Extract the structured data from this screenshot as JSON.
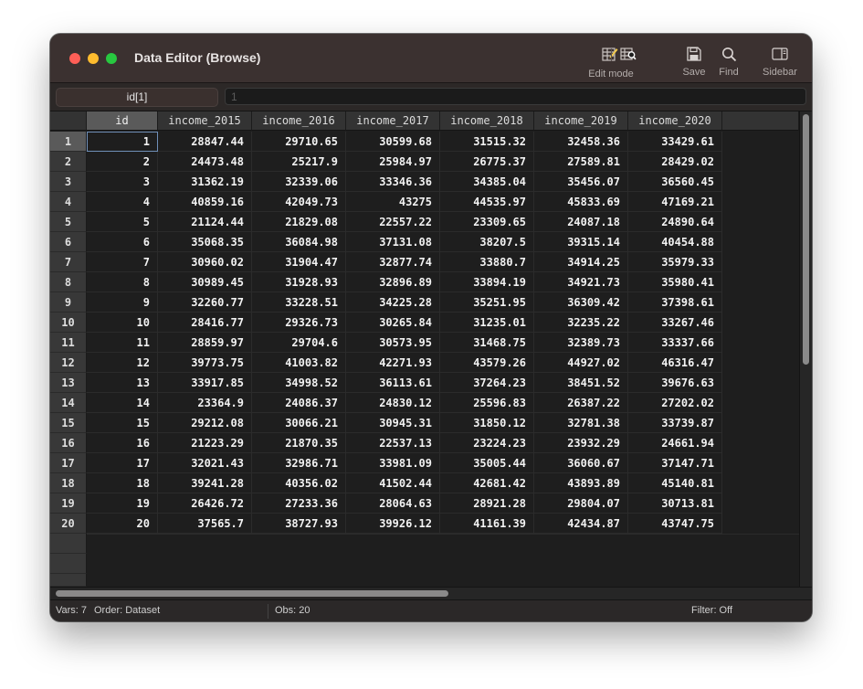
{
  "window": {
    "title": "Data Editor (Browse)"
  },
  "toolbar": {
    "edit_mode_label": "Edit mode",
    "save_label": "Save",
    "find_label": "Find",
    "sidebar_label": "Sidebar"
  },
  "command_bar": {
    "variable_cell": "id[1]",
    "value": "1"
  },
  "table": {
    "columns": [
      "id",
      "income_2015",
      "income_2016",
      "income_2017",
      "income_2018",
      "income_2019",
      "income_2020"
    ],
    "rows": [
      {
        "n": "1",
        "cells": [
          "1",
          "28847.44",
          "29710.65",
          "30599.68",
          "31515.32",
          "32458.36",
          "33429.61"
        ]
      },
      {
        "n": "2",
        "cells": [
          "2",
          "24473.48",
          "25217.9",
          "25984.97",
          "26775.37",
          "27589.81",
          "28429.02"
        ]
      },
      {
        "n": "3",
        "cells": [
          "3",
          "31362.19",
          "32339.06",
          "33346.36",
          "34385.04",
          "35456.07",
          "36560.45"
        ]
      },
      {
        "n": "4",
        "cells": [
          "4",
          "40859.16",
          "42049.73",
          "43275",
          "44535.97",
          "45833.69",
          "47169.21"
        ]
      },
      {
        "n": "5",
        "cells": [
          "5",
          "21124.44",
          "21829.08",
          "22557.22",
          "23309.65",
          "24087.18",
          "24890.64"
        ]
      },
      {
        "n": "6",
        "cells": [
          "6",
          "35068.35",
          "36084.98",
          "37131.08",
          "38207.5",
          "39315.14",
          "40454.88"
        ]
      },
      {
        "n": "7",
        "cells": [
          "7",
          "30960.02",
          "31904.47",
          "32877.74",
          "33880.7",
          "34914.25",
          "35979.33"
        ]
      },
      {
        "n": "8",
        "cells": [
          "8",
          "30989.45",
          "31928.93",
          "32896.89",
          "33894.19",
          "34921.73",
          "35980.41"
        ]
      },
      {
        "n": "9",
        "cells": [
          "9",
          "32260.77",
          "33228.51",
          "34225.28",
          "35251.95",
          "36309.42",
          "37398.61"
        ]
      },
      {
        "n": "10",
        "cells": [
          "10",
          "28416.77",
          "29326.73",
          "30265.84",
          "31235.01",
          "32235.22",
          "33267.46"
        ]
      },
      {
        "n": "11",
        "cells": [
          "11",
          "28859.97",
          "29704.6",
          "30573.95",
          "31468.75",
          "32389.73",
          "33337.66"
        ]
      },
      {
        "n": "12",
        "cells": [
          "12",
          "39773.75",
          "41003.82",
          "42271.93",
          "43579.26",
          "44927.02",
          "46316.47"
        ]
      },
      {
        "n": "13",
        "cells": [
          "13",
          "33917.85",
          "34998.52",
          "36113.61",
          "37264.23",
          "38451.52",
          "39676.63"
        ]
      },
      {
        "n": "14",
        "cells": [
          "14",
          "23364.9",
          "24086.37",
          "24830.12",
          "25596.83",
          "26387.22",
          "27202.02"
        ]
      },
      {
        "n": "15",
        "cells": [
          "15",
          "29212.08",
          "30066.21",
          "30945.31",
          "31850.12",
          "32781.38",
          "33739.87"
        ]
      },
      {
        "n": "16",
        "cells": [
          "16",
          "21223.29",
          "21870.35",
          "22537.13",
          "23224.23",
          "23932.29",
          "24661.94"
        ]
      },
      {
        "n": "17",
        "cells": [
          "17",
          "32021.43",
          "32986.71",
          "33981.09",
          "35005.44",
          "36060.67",
          "37147.71"
        ]
      },
      {
        "n": "18",
        "cells": [
          "18",
          "39241.28",
          "40356.02",
          "41502.44",
          "42681.42",
          "43893.89",
          "45140.81"
        ]
      },
      {
        "n": "19",
        "cells": [
          "19",
          "26426.72",
          "27233.36",
          "28064.63",
          "28921.28",
          "29804.07",
          "30713.81"
        ]
      },
      {
        "n": "20",
        "cells": [
          "20",
          "37565.7",
          "38727.93",
          "39926.12",
          "41161.39",
          "42434.87",
          "43747.75"
        ]
      }
    ]
  },
  "status": {
    "vars": "Vars: 7",
    "order": "Order: Dataset",
    "obs": "Obs: 20",
    "filter": "Filter: Off"
  }
}
